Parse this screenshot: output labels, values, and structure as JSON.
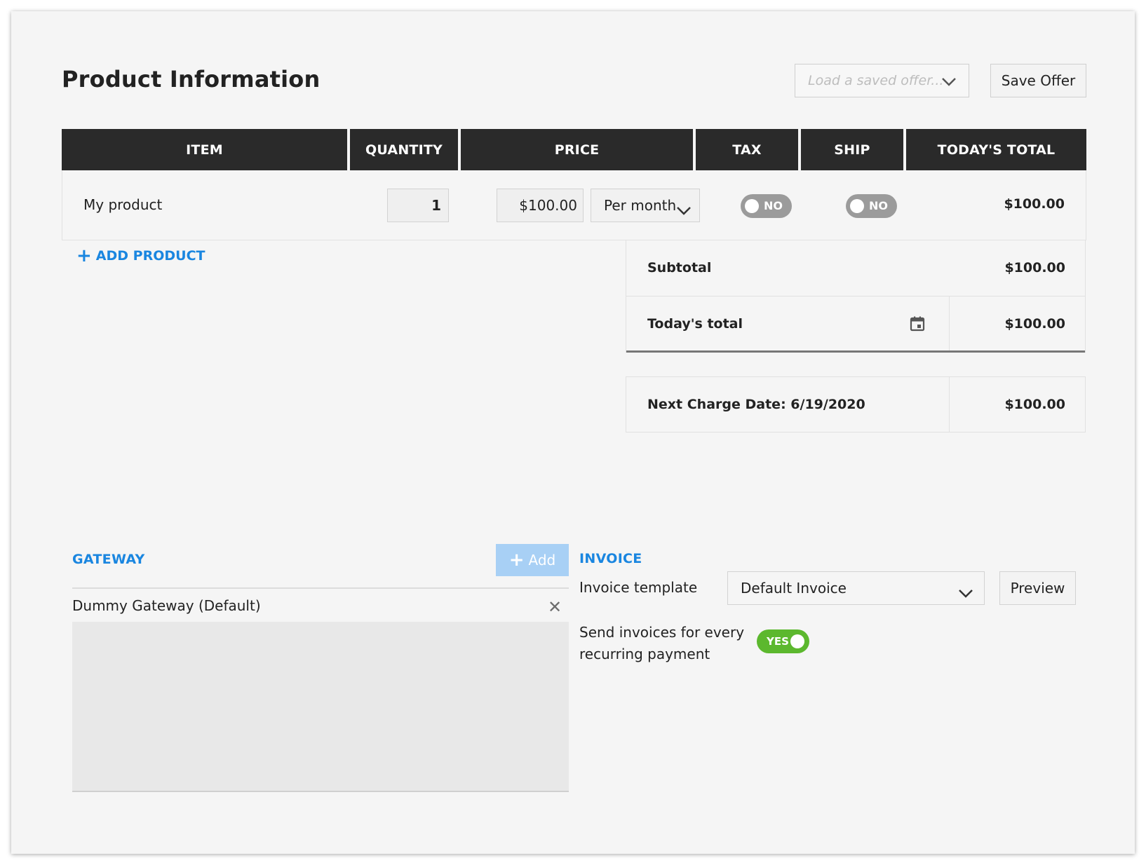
{
  "header": {
    "title": "Product Information",
    "load_offer_placeholder": "Load a saved offer...",
    "save_offer_label": "Save Offer"
  },
  "table": {
    "columns": [
      "ITEM",
      "QUANTITY",
      "PRICE",
      "TAX",
      "SHIP",
      "TODAY'S TOTAL"
    ],
    "rows": [
      {
        "item": "My product",
        "quantity": "1",
        "price": "$100.00",
        "period": "Per month",
        "tax": "NO",
        "ship": "NO",
        "total": "$100.00"
      }
    ]
  },
  "add_product_label": "ADD PRODUCT",
  "totals": {
    "subtotal_label": "Subtotal",
    "subtotal_value": "$100.00",
    "today_label": "Today's total",
    "today_value": "$100.00",
    "next_charge_label": "Next Charge Date: 6/19/2020",
    "next_charge_value": "$100.00"
  },
  "gateway": {
    "title": "GATEWAY",
    "add_label": "Add",
    "items": [
      "Dummy Gateway (Default)"
    ]
  },
  "invoice": {
    "title": "INVOICE",
    "template_label": "Invoice template",
    "template_value": "Default Invoice",
    "preview_label": "Preview",
    "send_label_line1": "Send invoices for every",
    "send_label_line2": "recurring payment",
    "send_toggle": "YES"
  },
  "colors": {
    "accent": "#1a86e0",
    "header_bg": "#2a2a2a",
    "toggle_on": "#5cb82e",
    "toggle_off": "#9b9b9b"
  }
}
